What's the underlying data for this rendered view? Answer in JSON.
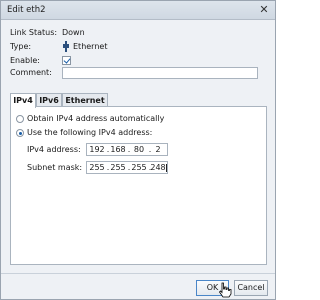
{
  "window": {
    "title": "Edit eth2",
    "close_glyph": "✕"
  },
  "fields": {
    "link_status_label": "Link Status:",
    "link_status_value": "Down",
    "type_label": "Type:",
    "type_value": "Ethernet",
    "type_icon": "ethernet-icon",
    "enable_label": "Enable:",
    "enable_checked": true,
    "comment_label": "Comment:",
    "comment_value": ""
  },
  "tabs": [
    {
      "label": "IPv4",
      "active": true
    },
    {
      "label": "IPv6",
      "active": false
    },
    {
      "label": "Ethernet",
      "active": false
    }
  ],
  "ipv4": {
    "obtain_auto_label": "Obtain IPv4 address automatically",
    "use_following_label": "Use the following IPv4 address:",
    "use_following_selected": true,
    "address_label": "IPv4 address:",
    "address": [
      "192",
      "168",
      "80",
      "2"
    ],
    "mask_label": "Subnet mask:",
    "mask": [
      "255",
      "255",
      "255",
      "248"
    ],
    "octet_separator": "."
  },
  "buttons": {
    "ok_label": "OK",
    "cancel_label": "Cancel"
  },
  "colors": {
    "accent": "#1a5fa8",
    "titlebar": "#d6dee7",
    "window_bg": "#eef1f5"
  }
}
